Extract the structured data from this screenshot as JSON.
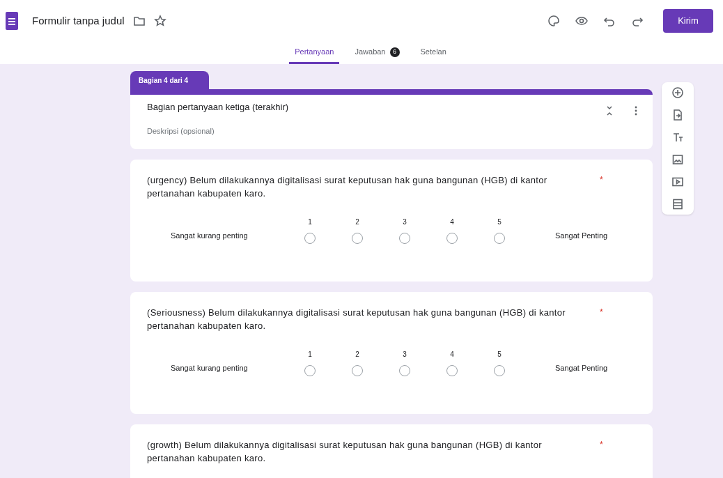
{
  "header": {
    "title": "Formulir tanpa judul",
    "send_button": "Kirim"
  },
  "tabs": [
    {
      "label": "Pertanyaan",
      "selected": true
    },
    {
      "label": "Jawaban",
      "selected": false,
      "badge": "6"
    },
    {
      "label": "Setelan",
      "selected": false
    }
  ],
  "section": {
    "tag": "Bagian 4 dari 4",
    "title": "Bagian pertanyaan ketiga (terakhir)",
    "description_placeholder": "Deskripsi (opsional)"
  },
  "questions": [
    {
      "text": "(urgency) Belum dilakukannya digitalisasi surat keputusan hak guna bangunan (HGB) di kantor pertanahan kabupaten karo.",
      "required_mark": "*",
      "scale": [
        {
          "label": "1",
          "selected": false
        },
        {
          "label": "2",
          "selected": false
        },
        {
          "label": "3",
          "selected": false
        },
        {
          "label": "4",
          "selected": false
        },
        {
          "label": "5",
          "selected": false
        }
      ],
      "low_label": "Sangat kurang penting",
      "high_label": "Sangat Penting"
    },
    {
      "text": "(Seriousness)  Belum dilakukannya digitalisasi surat keputusan hak guna bangunan (HGB) di kantor pertanahan kabupaten karo.",
      "required_mark": "*",
      "scale": [
        {
          "label": "1",
          "selected": false
        },
        {
          "label": "2",
          "selected": false
        },
        {
          "label": "3",
          "selected": false
        },
        {
          "label": "4",
          "selected": false
        },
        {
          "label": "5",
          "selected": false
        }
      ],
      "low_label": "Sangat kurang penting",
      "high_label": "Sangat Penting"
    },
    {
      "text": "(growth)  Belum dilakukannya digitalisasi surat keputusan hak guna bangunan (HGB) di kantor pertanahan kabupaten karo.",
      "required_mark": "*"
    }
  ]
}
